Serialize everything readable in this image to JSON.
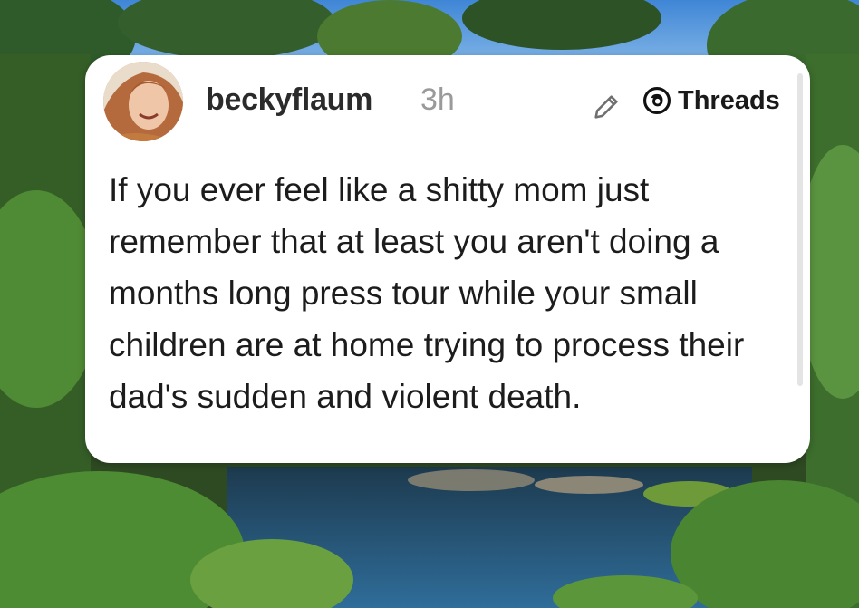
{
  "post": {
    "username": "beckyflaum",
    "timestamp": "3h",
    "platform_label": "Threads",
    "text": "If you ever feel like a shitty mom just remember that at least you aren't doing a months long press tour while your small children are at home trying to process their dad's sudden and violent death."
  },
  "icons": {
    "edit": "pencil-icon",
    "platform": "threads-logo-icon"
  },
  "colors": {
    "card_background": "#ffffff",
    "username": "#2b2b2b",
    "timestamp": "#9a9a9a",
    "text": "#1c1c1c"
  }
}
